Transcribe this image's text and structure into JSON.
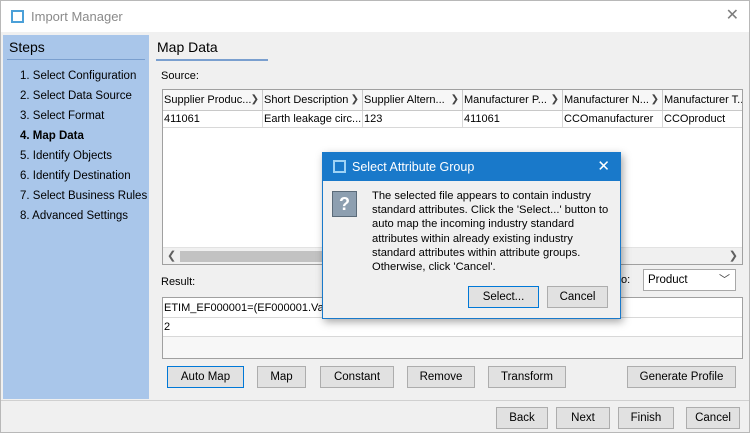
{
  "window": {
    "title": "Import Manager"
  },
  "steps": {
    "title": "Steps",
    "items": [
      {
        "label": "1. Select Configuration",
        "active": false
      },
      {
        "label": "2. Select Data Source",
        "active": false
      },
      {
        "label": "3. Select Format",
        "active": false
      },
      {
        "label": "4. Map Data",
        "active": true
      },
      {
        "label": "5. Identify Objects",
        "active": false
      },
      {
        "label": "6. Identify Destination",
        "active": false
      },
      {
        "label": "7. Select Business Rules",
        "active": false
      },
      {
        "label": "8. Advanced Settings",
        "active": false
      }
    ]
  },
  "main": {
    "title": "Map Data",
    "source_label": "Source:",
    "columns": [
      "Supplier Produc...",
      "Short Description",
      "Supplier Altern...",
      "Manufacturer P...",
      "Manufacturer N...",
      "Manufacturer T..."
    ],
    "rows": [
      [
        "411061",
        "Earth leakage circ...",
        "123",
        "411061",
        "CCOmanufacturer",
        "CCOproduct"
      ]
    ],
    "result_label": "Result:",
    "target_label": "to:",
    "target_value": "Product",
    "result_lines": [
      "ETIM_EF000001=(EF000001.Valu",
      "2"
    ]
  },
  "buttons": {
    "auto_map": "Auto Map",
    "map": "Map",
    "constant": "Constant",
    "remove": "Remove",
    "transform": "Transform",
    "generate_profile": "Generate Profile",
    "back": "Back",
    "next": "Next",
    "finish": "Finish",
    "cancel": "Cancel"
  },
  "dialog": {
    "title": "Select Attribute Group",
    "message": "The selected file appears to contain industry standard attributes. Click the 'Select...' button to auto map the incoming industry standard attributes within already existing industry standard attributes within attribute groups. Otherwise, click 'Cancel'.",
    "select_label": "Select...",
    "cancel_label": "Cancel"
  },
  "colors": {
    "steps_bg": "#a9c6ea",
    "dialog_title_bg": "#1979ca",
    "focus_border": "#0078d7"
  },
  "icons": {
    "app": "window-icon",
    "close": "close-icon",
    "question": "question-icon",
    "sort": "chevron-right-icon",
    "dropdown": "chevron-down-icon"
  }
}
